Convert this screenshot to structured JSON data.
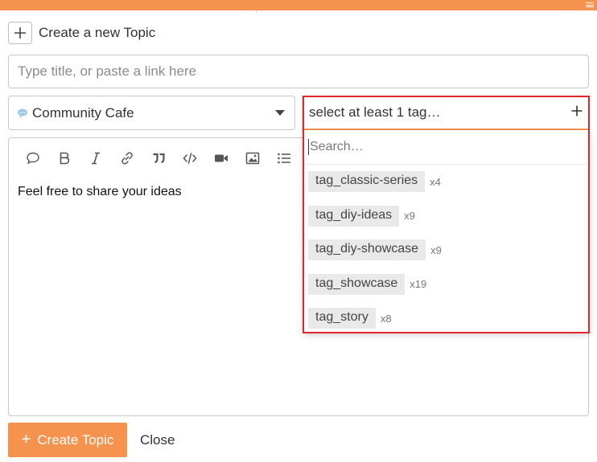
{
  "header": {
    "title": "Create a new Topic"
  },
  "title_input": {
    "placeholder": "Type title, or paste a link here"
  },
  "category": {
    "selected": "Community Cafe"
  },
  "editor": {
    "toolbar": [
      {
        "icon": "quote-bubble-icon"
      },
      {
        "icon": "bold-icon"
      },
      {
        "icon": "italic-icon"
      },
      {
        "icon": "link-icon"
      },
      {
        "icon": "blockquote-icon"
      },
      {
        "icon": "code-icon"
      },
      {
        "icon": "video-icon"
      },
      {
        "icon": "image-icon"
      },
      {
        "icon": "bullet-list-icon"
      },
      {
        "icon": "numbered-list-icon"
      }
    ],
    "body_text": "Feel free to share your ideas"
  },
  "tag_chooser": {
    "placeholder": "select at least 1 tag…",
    "search_placeholder": "Search…",
    "tags": [
      {
        "name": "tag_classic-series",
        "count": "x4"
      },
      {
        "name": "tag_diy-ideas",
        "count": "x9"
      },
      {
        "name": "tag_diy-showcase",
        "count": "x9"
      },
      {
        "name": "tag_showcase",
        "count": "x19"
      },
      {
        "name": "tag_story",
        "count": "x8"
      }
    ]
  },
  "footer": {
    "create_label": "Create Topic",
    "close_label": "Close"
  },
  "colors": {
    "accent": "#f5924e",
    "highlight": "#e3262b"
  }
}
